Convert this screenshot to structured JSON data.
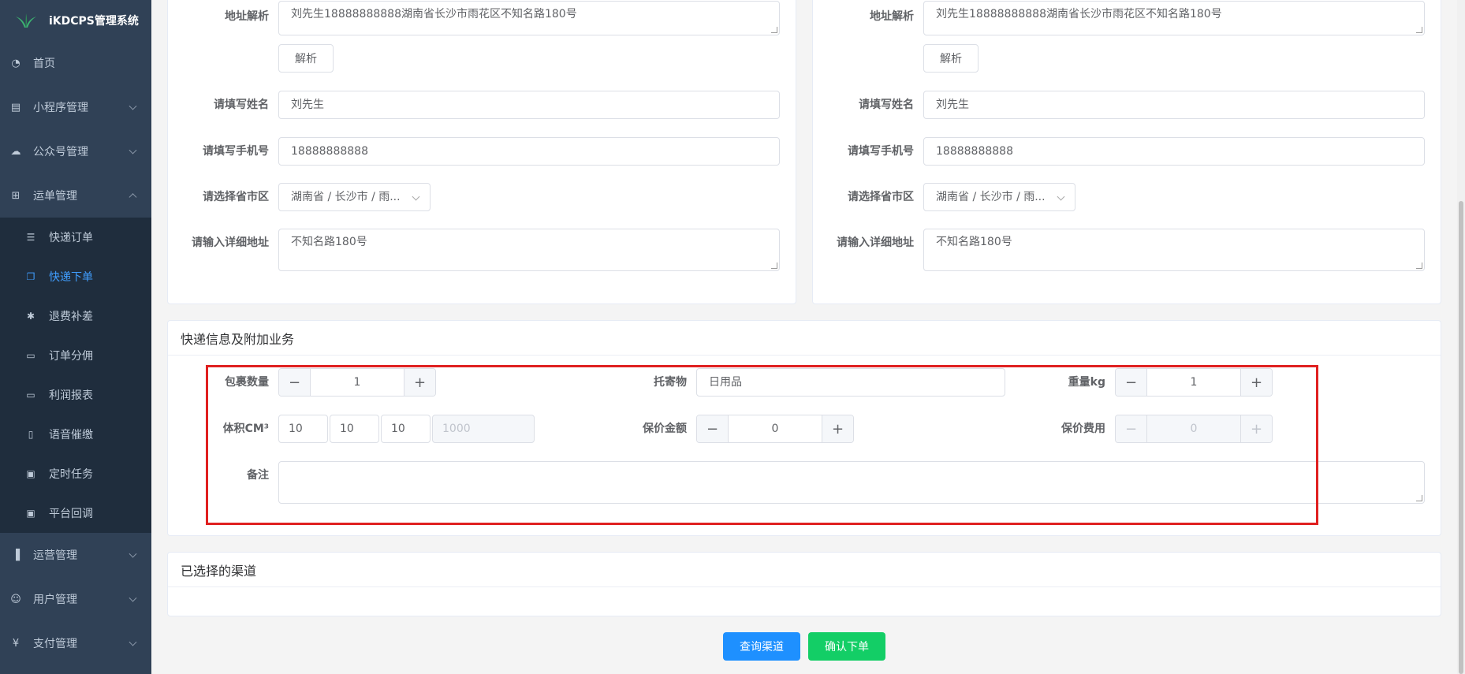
{
  "app": {
    "title": "iKDCPS管理系统"
  },
  "sidebar": {
    "items": [
      {
        "label": "首页",
        "icon": "dashboard-icon"
      },
      {
        "label": "小程序管理",
        "icon": "miniprogram-icon"
      },
      {
        "label": "公众号管理",
        "icon": "wechat-icon"
      },
      {
        "label": "运单管理",
        "icon": "grid-icon"
      }
    ],
    "subitems": [
      {
        "label": "快递订单",
        "icon": "list-icon"
      },
      {
        "label": "快递下单",
        "icon": "copy-icon"
      },
      {
        "label": "退费补差",
        "icon": "bug-icon"
      },
      {
        "label": "订单分佣",
        "icon": "monitor-icon"
      },
      {
        "label": "利润报表",
        "icon": "monitor-icon"
      },
      {
        "label": "语音催缴",
        "icon": "phone-icon"
      },
      {
        "label": "定时任务",
        "icon": "doc-icon"
      },
      {
        "label": "平台回调",
        "icon": "doc-icon"
      }
    ],
    "bottom_items": [
      {
        "label": "运营管理",
        "icon": "bar-chart-icon"
      },
      {
        "label": "用户管理",
        "icon": "user-icon"
      },
      {
        "label": "支付管理",
        "icon": "yen-icon"
      }
    ]
  },
  "sender": {
    "parse_label": "地址解析",
    "parse_value": "刘先生18888888888湖南省长沙市雨花区不知名路180号",
    "parse_button": "解析",
    "name_label": "请填写姓名",
    "name_value": "刘先生",
    "phone_label": "请填写手机号",
    "phone_value": "18888888888",
    "region_label": "请选择省市区",
    "region_value": "湖南省 / 长沙市 / 雨...",
    "address_label": "请输入详细地址",
    "address_value": "不知名路180号"
  },
  "receiver": {
    "parse_label": "地址解析",
    "parse_value": "刘先生18888888888湖南省长沙市雨花区不知名路180号",
    "parse_button": "解析",
    "name_label": "请填写姓名",
    "name_value": "刘先生",
    "phone_label": "请填写手机号",
    "phone_value": "18888888888",
    "region_label": "请选择省市区",
    "region_value": "湖南省 / 长沙市 / 雨...",
    "address_label": "请输入详细地址",
    "address_value": "不知名路180号"
  },
  "express": {
    "title": "快递信息及附加业务",
    "package_count_label": "包裹数量",
    "package_count": "1",
    "goods_label": "托寄物",
    "goods_value": "日用品",
    "weight_label": "重量kg",
    "weight_value": "1",
    "volume_label": "体积CM³",
    "volume_l": "10",
    "volume_w": "10",
    "volume_h": "10",
    "volume_total": "1000",
    "insured_label": "保价金额",
    "insured_value": "0",
    "insured_fee_label": "保价费用",
    "insured_fee_value": "0",
    "remark_label": "备注",
    "minus": "−",
    "plus": "+"
  },
  "channel": {
    "title": "已选择的渠道"
  },
  "actions": {
    "query_label": "查询渠道",
    "confirm_label": "确认下单",
    "query_color": "#1e90ff",
    "confirm_color": "#13ce66"
  },
  "colors": {
    "sidebar_bg": "#304156",
    "active": "#409eff",
    "highlight": "#e02020"
  }
}
